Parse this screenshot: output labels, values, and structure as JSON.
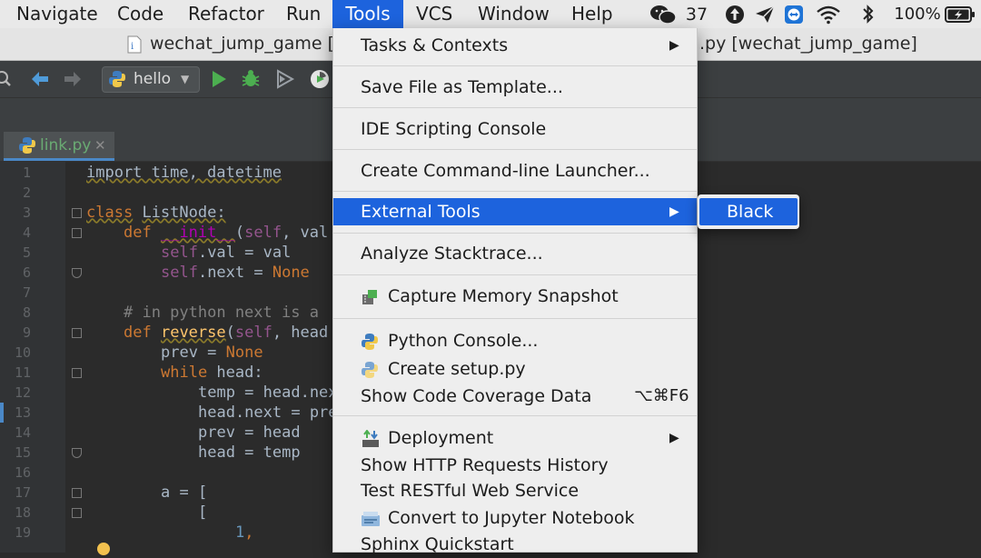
{
  "menubar": {
    "items": [
      "Navigate",
      "Code",
      "Refactor",
      "Run",
      "Tools",
      "VCS",
      "Window",
      "Help"
    ],
    "active": "Tools",
    "status": {
      "wechat_count": "37",
      "battery": "100%"
    }
  },
  "window": {
    "title_left": "wechat_jump_game [~",
    "title_right": ".py [wechat_jump_game]"
  },
  "toolbar": {
    "run_config": "hello"
  },
  "editor": {
    "tab_label": "link.py",
    "line_numbers": [
      "1",
      "2",
      "3",
      "4",
      "5",
      "6",
      "7",
      "8",
      "9",
      "10",
      "11",
      "12",
      "13",
      "14",
      "15",
      "16",
      "17",
      "18",
      "19"
    ],
    "lines": {
      "l1": "import time, datetime",
      "l3a": "class",
      "l3b": "ListNode:",
      "l4a": "def",
      "l4b": "__init__",
      "l4c": "(",
      "l4d": "self",
      "l4e": ", val",
      "l5a": "self",
      "l5b": ".val = val",
      "l6a": "self",
      "l6b": ".next = ",
      "l6c": "None",
      "l8": "# in python next is a",
      "l9a": "def",
      "l9b": "reverse",
      "l9c": "(",
      "l9d": "self",
      "l9e": ", head",
      "l10a": "prev = ",
      "l10b": "None",
      "l11a": "while",
      "l11b": " head:",
      "l12": "temp = head.nex",
      "l13": "head.next = pre",
      "l14": "prev = head",
      "l15": "head = temp",
      "l17": "a = [",
      "l18": "[",
      "l19a": "1",
      "l19b": ","
    }
  },
  "tools_menu": {
    "items": [
      {
        "label": "Tasks & Contexts",
        "submenu": "▶"
      },
      {
        "label": "Save File as Template..."
      },
      {
        "label": "IDE Scripting Console"
      },
      {
        "label": "Create Command-line Launcher..."
      },
      {
        "label": "External Tools",
        "submenu": "▶"
      },
      {
        "label": "Analyze Stacktrace..."
      },
      {
        "label": "Capture Memory Snapshot",
        "icon": "memory-snapshot-icon"
      },
      {
        "label": "Python Console...",
        "icon": "python-icon"
      },
      {
        "label": "Create setup.py",
        "icon": "python-icon"
      },
      {
        "label": "Show Code Coverage Data",
        "shortcut": "⌥⌘F6"
      },
      {
        "label": "Deployment",
        "icon": "deployment-icon",
        "submenu": "▶"
      },
      {
        "label": "Show HTTP Requests History"
      },
      {
        "label": "Test RESTful Web Service"
      },
      {
        "label": "Convert to Jupyter Notebook",
        "icon": "jupyter-icon"
      },
      {
        "label": "Sphinx Quickstart"
      }
    ]
  },
  "external_tools_submenu": {
    "items": [
      "Black"
    ]
  },
  "colors": {
    "menu_highlight": "#1d63dd",
    "editor_bg": "#2b2b2b",
    "keyword": "#cc7832",
    "self": "#94558d",
    "function": "#ffc66d"
  }
}
